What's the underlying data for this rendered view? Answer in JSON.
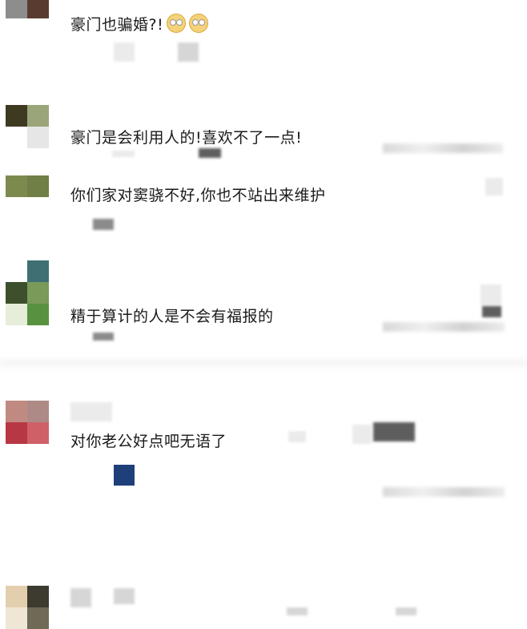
{
  "comments": [
    {
      "text": "豪门也骗婚?!",
      "emoji": [
        "eye-roll-emoji",
        "eye-roll-emoji"
      ]
    },
    {
      "text": "豪门是会利用人的!喜欢不了一点!"
    },
    {
      "text": "你们家对窦骁不好,你也不站出来维护"
    },
    {
      "text": "精于算计的人是不会有福报的"
    },
    {
      "text": "对你老公好点吧无语了"
    }
  ],
  "colors": {
    "accent_blue": "#1f3f7a",
    "pixel_gray": "#d6d6d6"
  }
}
